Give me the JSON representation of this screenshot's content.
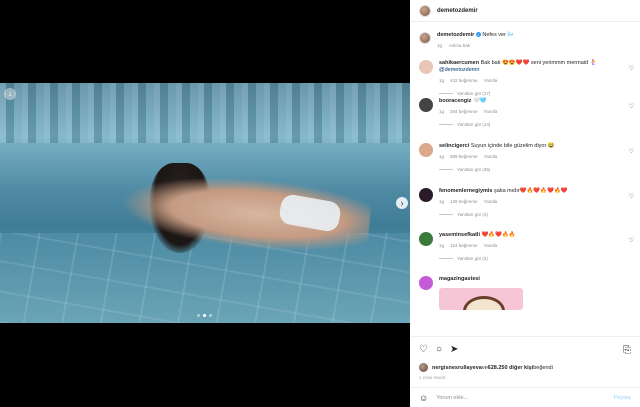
{
  "post": {
    "username": "demetozdemir",
    "caption": "Nefes ver 🌬️",
    "caption_time": "1g",
    "caption_see_translation": "Aslına bak",
    "colors": {
      "verified": "#3897f0",
      "link": "#00376b",
      "post_button": "#b2dffc"
    }
  },
  "media": {
    "next_arrow": "›",
    "download_icon": "↓",
    "dots_count": 3,
    "active_dot": 1
  },
  "comments": [
    {
      "user": "sahikaercumen",
      "text": "Bak bak 😍😍❤️❤️ seni yerimmm mermaid 🧜‍♀️ ",
      "mention": "@demetozdemir",
      "time": "1g",
      "likes": "442 beğenme",
      "reply": "Yanıtla",
      "view_replies": "Yanıtları gör (17)",
      "avatar_color": "#e8c6b8"
    },
    {
      "user": "booracengiz",
      "text": "🤍🩵",
      "mention": "",
      "time": "1g",
      "likes": "284 beğenme",
      "reply": "Yanıtla",
      "view_replies": "Yanıtları gör (14)",
      "avatar_color": "#444444"
    },
    {
      "user": "selincigerci",
      "text": "Suyun içinde bile güzelim diyor 😂",
      "mention": "",
      "time": "1g",
      "likes": "589 beğenme",
      "reply": "Yanıtla",
      "view_replies": "Yanıtları gör (36)",
      "avatar_color": "#d9a98a"
    },
    {
      "user": "fenomenlernegiymis",
      "text": "şaka mıdır❤️🔥❤️🔥❤️🔥❤️",
      "mention": "",
      "time": "1g",
      "likes": "129 beğenme",
      "reply": "Yanıtla",
      "view_replies": "Yanıtları gör (4)",
      "avatar_color": "#2b1a2a"
    },
    {
      "user": "yaseminsefkatli",
      "text": "❤️🔥❤️🔥🔥",
      "mention": "",
      "time": "1g",
      "likes": "124 beğenme",
      "reply": "Yanıtla",
      "view_replies": "Yanıtları gör (2)",
      "avatar_color": "#3a7a3a"
    },
    {
      "user": "magazingastesi",
      "text": "",
      "mention": "",
      "time": "",
      "likes": "",
      "reply": "",
      "view_replies": "",
      "avatar_color": "#c45bd6"
    }
  ],
  "actions": {
    "like_icon": "♡",
    "comment_icon": "○",
    "share_icon": "➤",
    "save_icon": "⎘",
    "liked_by_user": "nergisnesrullayeva",
    "liked_by_connector": " ve ",
    "liked_by_others": "628.250 diğer kişi",
    "liked_by_suffix": " beğendi",
    "date": "1 GÜN ÖNCE"
  },
  "add_comment": {
    "emoji_icon": "☺",
    "placeholder": "Yorum ekle...",
    "post_label": "Paylaş"
  }
}
